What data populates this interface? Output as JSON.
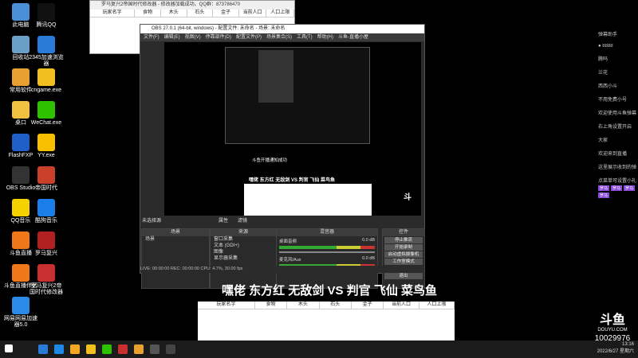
{
  "desktop": {
    "icons": [
      {
        "label": "此电脑",
        "color": "#4a90d9"
      },
      {
        "label": "腾讯QQ",
        "color": "#111"
      },
      {
        "label": "回收站",
        "color": "#6aa0c8"
      },
      {
        "label": "2345加速浏览器",
        "color": "#2a7ad8"
      },
      {
        "label": "常用软件",
        "color": "#e8a030"
      },
      {
        "label": "cngame.exe",
        "color": "#f2c01e"
      },
      {
        "label": "桌口",
        "color": "#f0c040"
      },
      {
        "label": "WeChat.exe",
        "color": "#2dc100"
      },
      {
        "label": "FlashFXP",
        "color": "#1e5fc8"
      },
      {
        "label": "YY.exe",
        "color": "#f6c000"
      },
      {
        "label": "OBS Studio",
        "color": "#333"
      },
      {
        "label": "帝国时代",
        "color": "#c8402a"
      },
      {
        "label": "QQ音乐",
        "color": "#f5d100"
      },
      {
        "label": "酷狗音乐",
        "color": "#1a7ee8"
      },
      {
        "label": "斗鱼直播",
        "color": "#f07818"
      },
      {
        "label": "罗马复兴",
        "color": "#b02020"
      },
      {
        "label": "斗鱼直播伴侣",
        "color": "#f07818"
      },
      {
        "label": "罗马复兴2帝国时代修改器",
        "color": "#c83030"
      },
      {
        "label": "网易网易加速器5.0",
        "color": "#2a8ae8"
      }
    ]
  },
  "stats_window": {
    "title": "罗马复兴2帝国时代修改器 - 修改器加载成功。QQ群：873786470",
    "columns": [
      "玩家名字",
      "食物",
      "木头",
      "石头",
      "金子",
      "当前人口",
      "人口上限"
    ]
  },
  "obs": {
    "title": "OBS 27.0.1 (64-bit, windows) - 配置文件: 未命名 - 场景: 未命名",
    "menu": [
      "文件(F)",
      "编辑(E)",
      "视图(V)",
      "停靠部件(D)",
      "配置文件(P)",
      "场景集合(S)",
      "工具(T)",
      "帮助(H)",
      "斗鱼-直播小屋"
    ],
    "no_source": "未选择源",
    "properties": "属性",
    "filters": "滤镜",
    "panels": {
      "scenes": {
        "header": "场景",
        "items": [
          "场景"
        ]
      },
      "sources": {
        "header": "来源",
        "items": [
          "窗口采集",
          "文本 (GDI+)",
          "图像",
          "显示器采集"
        ]
      },
      "mixer": {
        "header": "混音器",
        "tracks": [
          {
            "name": "桌面音频",
            "db": "0.0 dB"
          },
          {
            "name": "麦克风/Aux",
            "db": "0.0 dB"
          }
        ]
      },
      "controls": {
        "header": "控件",
        "buttons": [
          "停止推流",
          "开始录制",
          "启动虚拟摄像机",
          "工作室模式",
          "设置",
          "退出"
        ],
        "tabs": [
          "控件",
          "转场特效"
        ]
      }
    },
    "status": "LIVE: 00:00:00   REC: 00:00:00   CPU: 4.7%, 30.00 fps",
    "preview_caption": "嘿佬 东方红 无敌剑 VS 判官 飞仙 菜鸟鱼",
    "preview_note": "斗鱼开播通知成功"
  },
  "caption": "嘿佬 东方红 无敌剑 VS 判官 飞仙 菜鸟鱼",
  "table2": {
    "columns": [
      "玩家名字",
      "食物",
      "木头",
      "石头",
      "金子",
      "当前人口",
      "人口上限"
    ]
  },
  "chat": {
    "lines": [
      "弹幕助手",
      "● 8888",
      "腾吗",
      "兰花",
      "西西小斗",
      "不用免费小号",
      "欢迎使用斗鱼弹幕",
      "右上角设置开启",
      "大家",
      "欢迎来到直播",
      "这里展示收到的弹",
      "点菜单可设置小礼"
    ],
    "badges": [
      "罗马",
      "罗马",
      "罗马",
      "罗马"
    ]
  },
  "watermark": {
    "logo": "斗鱼",
    "sub": "DOUYU.COM",
    "room": "10029976"
  },
  "taskbar": {
    "time": "13:16",
    "date": "2022/6/27 星期六"
  }
}
